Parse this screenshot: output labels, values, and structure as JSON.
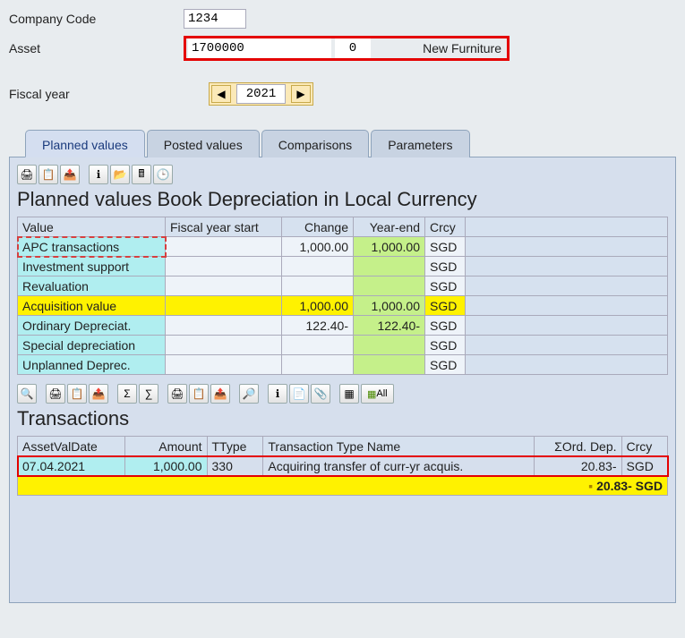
{
  "fields": {
    "company_label": "Company Code",
    "company_value": "1234",
    "asset_label": "Asset",
    "asset_value": "1700000",
    "asset_sub": "0",
    "asset_desc": "New Furniture",
    "fiscal_label": "Fiscal year",
    "fiscal_value": "2021"
  },
  "tabs": [
    "Planned values",
    "Posted values",
    "Comparisons",
    "Parameters"
  ],
  "planned": {
    "title": "Planned values Book Depreciation in Local Currency",
    "cols": [
      "Value",
      "Fiscal year start",
      "Change",
      "Year-end",
      "Crcy"
    ],
    "rows": [
      {
        "label": "APC transactions",
        "fys": "",
        "chg": "1,000.00",
        "ye": "1,000.00",
        "crcy": "SGD",
        "cls": [
          "apc-cell",
          "plain-bg",
          "plain-bg",
          "lime",
          "plain-bg"
        ]
      },
      {
        "label": "Investment support",
        "fys": "",
        "chg": "",
        "ye": "",
        "crcy": "SGD",
        "cls": [
          "teal",
          "plain-bg",
          "plain-bg",
          "lime",
          "plain-bg"
        ]
      },
      {
        "label": "Revaluation",
        "fys": "",
        "chg": "",
        "ye": "",
        "crcy": "SGD",
        "cls": [
          "teal",
          "plain-bg",
          "plain-bg",
          "lime",
          "plain-bg"
        ]
      },
      {
        "label": "Acquisition value",
        "fys": "",
        "chg": "1,000.00",
        "ye": "1,000.00",
        "crcy": "SGD",
        "cls": [
          "yellow",
          "yellow",
          "yellow",
          "lime",
          "yellow"
        ]
      },
      {
        "label": "Ordinary Depreciat.",
        "fys": "",
        "chg": "122.40-",
        "ye": "122.40-",
        "crcy": "SGD",
        "cls": [
          "teal",
          "plain-bg",
          "plain-bg",
          "lime",
          "plain-bg"
        ]
      },
      {
        "label": "Special depreciation",
        "fys": "",
        "chg": "",
        "ye": "",
        "crcy": "SGD",
        "cls": [
          "teal",
          "plain-bg",
          "plain-bg",
          "lime",
          "plain-bg"
        ]
      },
      {
        "label": "Unplanned Deprec.",
        "fys": "",
        "chg": "",
        "ye": "",
        "crcy": "SGD",
        "cls": [
          "teal",
          "plain-bg",
          "plain-bg",
          "lime",
          "plain-bg"
        ]
      }
    ]
  },
  "tx": {
    "title": "Transactions",
    "all_label": "All",
    "cols": [
      "AssetValDate",
      "Amount",
      "TType",
      "Transaction Type Name",
      "ΣOrd. Dep.",
      "Crcy"
    ],
    "rows": [
      {
        "date": "07.04.2021",
        "amount": "1,000.00",
        "ttype": "330",
        "name": "Acquiring transfer of curr-yr acquis.",
        "dep": "20.83-",
        "crcy": "SGD"
      }
    ],
    "total": "20.83- SGD"
  }
}
